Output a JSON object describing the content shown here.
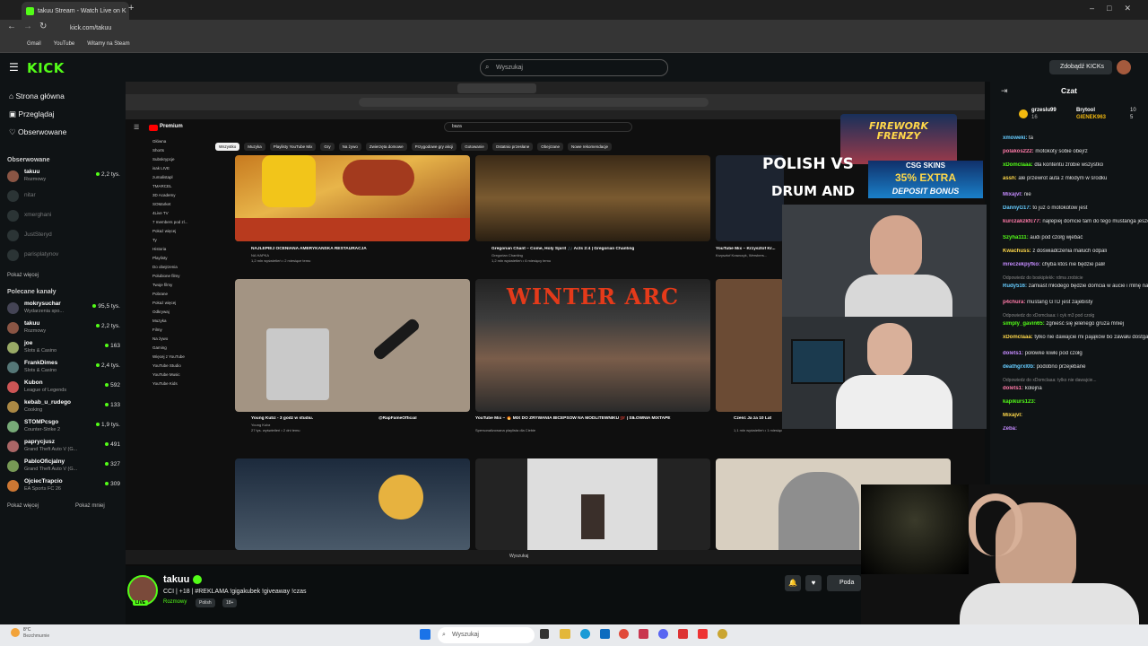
{
  "browser": {
    "tab_title": "takuu Stream - Watch Live on K",
    "url": "kick.com/takuu",
    "bookmarks": [
      "Gmail",
      "YouTube",
      "Witamy na Steam"
    ]
  },
  "header": {
    "search_placeholder": "Wyszukaj",
    "kicks_button": "Zdobądź KICKs"
  },
  "sidebar": {
    "nav": [
      "Strona główna",
      "Przeglądaj",
      "Obserwowane"
    ],
    "followed_title": "Obserwowane",
    "followed": [
      {
        "name": "takuu",
        "sub": "Rozmowy",
        "count": "2,2 tys.",
        "live": true
      },
      {
        "name": "nitar",
        "sub": "",
        "count": "",
        "live": false
      },
      {
        "name": "xmerghani",
        "sub": "",
        "count": "",
        "live": false
      },
      {
        "name": "JustSteryd",
        "sub": "",
        "count": "",
        "live": false
      },
      {
        "name": "parisplatynov",
        "sub": "",
        "count": "",
        "live": false
      }
    ],
    "show_more_1": "Pokaż więcej",
    "recommended_title": "Polecane kanały",
    "recommended": [
      {
        "name": "mokrysuchar",
        "sub": "Wydarzenia spo...",
        "count": "95,5 tys."
      },
      {
        "name": "takuu",
        "sub": "Rozmowy",
        "count": "2,2 tys."
      },
      {
        "name": "joe",
        "sub": "Slots & Casino",
        "count": "163"
      },
      {
        "name": "FrankDimes",
        "sub": "Slots & Casino",
        "count": "2,4 tys."
      },
      {
        "name": "Kubon",
        "sub": "League of Legends",
        "count": "592"
      },
      {
        "name": "kebab_u_rudego",
        "sub": "Cooking",
        "count": "133"
      },
      {
        "name": "STOMPcsgo",
        "sub": "Counter-Strike 2",
        "count": "1,9 tys."
      },
      {
        "name": "paprycjusz",
        "sub": "Grand Theft Auto V (G...",
        "count": "491"
      },
      {
        "name": "PabloOficjalny",
        "sub": "Grand Theft Auto V (G...",
        "count": "327"
      },
      {
        "name": "OjciecTrapcio",
        "sub": "EA Sports FC 26",
        "count": "309"
      }
    ],
    "show_more_2": "Pokaż więcej",
    "show_less": "Pokaż mniej"
  },
  "stream_screen": {
    "yt_search": "baza",
    "premium": "Premium",
    "chips": [
      "Wszystko",
      "Muzyka",
      "Playlisty YouTube Mix",
      "Gry",
      "Na żywo",
      "Zwierzęta domowe",
      "Przygodowe gry akcji",
      "Gotowanie",
      "Ostatnio przesłane",
      "Obejrzane",
      "Nowe rekomendacje"
    ],
    "yt_sidebar": [
      "Główna",
      "Shorts",
      "Subskrypcje",
      "isak LIVE",
      "zumalistapl",
      "TMARCEL",
      "3D Academy",
      "SOMarket",
      "4Live TV",
      "7 members pod zl...",
      "Pokaż więcej",
      "Ty",
      "Historia",
      "Playlisty",
      "Do obejrzenia",
      "Polubione filmy",
      "Twoje filmy",
      "Pobrane",
      "Pokaż więcej",
      "Odkrywaj",
      "Muzyka",
      "Filmy",
      "Na żywo",
      "Gaming",
      "Więcej z YouTube",
      "YouTube Studio",
      "YouTube Music",
      "YouTube Kids"
    ],
    "videos": [
      {
        "title": "NAJLEPIEJ OCENIANA AMERYKAŃSKA RESTAURACJA",
        "channel": "NA HAPKA",
        "meta": "1,2 mln wyświetleń • 2 miesiące temu"
      },
      {
        "title": "Gregorian Chant – Come, Holy Spirit 🎵 Acts 2:4 | Gregorian Chanting",
        "channel": "Gregorian Chanting",
        "meta": "1,2 mln wyświetleń • 6 miesięcy temu"
      },
      {
        "title": "YouTube Mix – Krzysztof Kr...",
        "channel": "Krzysztof Krawczyk, Wersbers...",
        "meta": ""
      },
      {
        "title": "Young Kubz - 3 godz w studiu.",
        "channel": "Young Kubz",
        "meta": "27 tys. wyświetleń • 2 dni temu"
      },
      {
        "title": "@RapFameOfficial",
        "channel": "",
        "meta": ""
      },
      {
        "title": "YouTube Mix – 🔥 MIX DO ZRYWANIA BICEPSÓW NA MODLITEWNIKU 💯 | SIŁOWNIA MIXTAPE",
        "channel": "Spersonalizowana playlista dla Ciebie",
        "meta": ""
      },
      {
        "title": "Cześć Ja za 10 Lat",
        "channel": "",
        "meta": "1,1 mln wyświetleń • 1 miesiąc temu"
      }
    ],
    "winter_arc": "WINTER ARC",
    "taskbar_search": "Wyszukaj"
  },
  "overlays": {
    "firework": "FIREWORK FRENZY",
    "csgo": "CSG SKINS",
    "extra": "35% EXTRA",
    "deposit": "DEPOSIT BONUS",
    "polish": "POLISH VS",
    "drum": "DRUM AND"
  },
  "chat": {
    "title": "Czat",
    "top": [
      {
        "name": "grzeslu99",
        "sub": "16",
        "count": "10"
      },
      {
        "name": "Brytool",
        "sub": "",
        "count": ""
      },
      {
        "name": "GIENEK963",
        "sub": "",
        "count": "5"
      }
    ],
    "messages": [
      {
        "user": "xmoweki:",
        "text": "ta",
        "reply": ""
      },
      {
        "user": "polakos222:",
        "text": "motokoty sobie obejrz",
        "reply": ""
      },
      {
        "user": "xDomclaaa:",
        "text": "dla kontentu zrobie wszystko",
        "reply": ""
      },
      {
        "user": "assh:",
        "text": "ale przewrot auta z młodym w środku",
        "reply": ""
      },
      {
        "user": "Mixajvl:",
        "text": "nie",
        "reply": ""
      },
      {
        "user": "DannyG17:",
        "text": "to już o motokotow jest",
        "reply": ""
      },
      {
        "user": "kurczakzkfc77:",
        "text": "najlepiej domcie tam do tego mustanga jeszcze XD",
        "reply": ""
      },
      {
        "user": "Szyha111:",
        "text": "audi pod czołg wjebać",
        "reply": ""
      },
      {
        "user": "Kwachuss:",
        "text": "z doświadczenia małuch odpali",
        "reply": ""
      },
      {
        "user": "mreczekpyfko:",
        "text": "chyba ktoś nie będzie palił",
        "reply": ""
      },
      {
        "user": "Rudy516:",
        "text": "zamiast młodego będzie domcia w aucie i mlnę na lacie",
        "reply": "Odpowiedz do boskiplekk: rdma zrobicie"
      },
      {
        "user": "p4chura:",
        "text": "mustang GTD jest zajebisty",
        "reply": ""
      },
      {
        "user": "simply_gavin65:",
        "text": "zgnieść się jelenego gruza mniej",
        "reply": "Odpowiedz do xDomclaaa: i cyk m3 pod czołg"
      },
      {
        "user": "xDomclaaa:",
        "text": "tylko nie dawajcie mi pająków bo zawału dostgane",
        "reply": ""
      },
      {
        "user": "dolets1:",
        "text": "połówke kiwki pod czołg",
        "reply": ""
      },
      {
        "user": "deathgrxl0b:",
        "text": "podobno przejebane",
        "reply": ""
      },
      {
        "user": "dolets1:",
        "text": "kolejna",
        "reply": "Odpowiedz do xDomclaaa: tylko nie dawajcie..."
      },
      {
        "user": "kapikurs123:",
        "text": "",
        "reply": ""
      },
      {
        "user": "Mixajvl:",
        "text": "",
        "reply": ""
      },
      {
        "user": "Zeba:",
        "text": "",
        "reply": ""
      }
    ]
  },
  "stream_info": {
    "channel": "takuu",
    "title": "CCI | +18 | #REKLAMA !gigakubek !giveaway !czas",
    "tags": [
      "Rozmowy",
      "Polish",
      "18+"
    ],
    "live_badge": "LIVE",
    "support_btn": "Poda"
  },
  "windows": {
    "weather_temp": "8°C",
    "weather_desc": "Bezchmurnie",
    "search": "Wyszukaj"
  }
}
